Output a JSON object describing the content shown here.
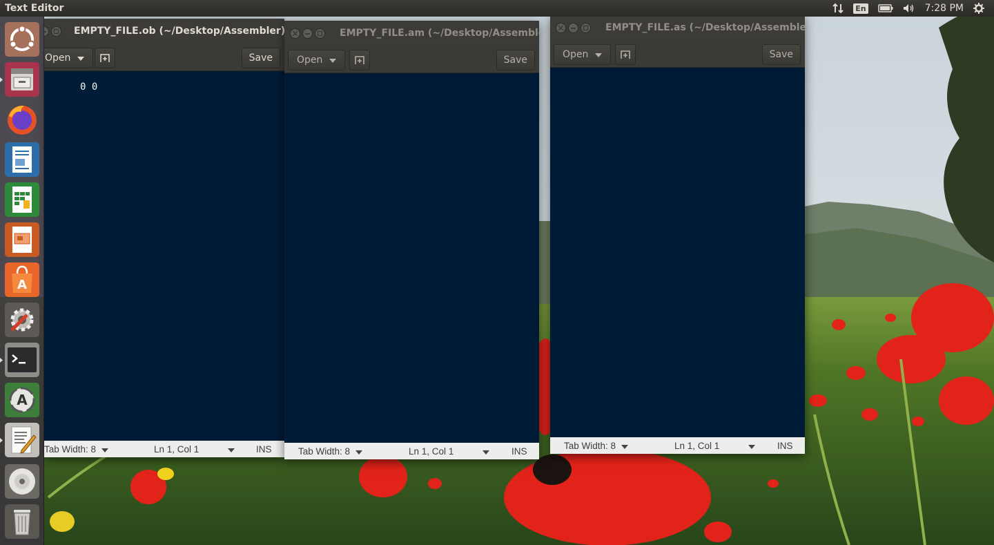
{
  "panel": {
    "app_title": "Text Editor",
    "keyboard_layout": "En",
    "clock": "7:28 PM",
    "icons": [
      "network-transfer-icon",
      "keyboard-layout-icon",
      "battery-icon",
      "volume-icon",
      "system-gear-icon"
    ]
  },
  "launcher": {
    "items": [
      {
        "name": "ubuntu-dash-icon"
      },
      {
        "name": "files-icon"
      },
      {
        "name": "firefox-icon"
      },
      {
        "name": "libreoffice-writer-icon"
      },
      {
        "name": "libreoffice-calc-icon"
      },
      {
        "name": "libreoffice-impress-icon"
      },
      {
        "name": "ubuntu-software-icon"
      },
      {
        "name": "system-settings-icon"
      },
      {
        "name": "terminal-icon"
      },
      {
        "name": "software-updater-icon"
      },
      {
        "name": "text-editor-icon"
      },
      {
        "name": "dvd-drive-icon"
      },
      {
        "name": "trash-icon"
      }
    ]
  },
  "windows": [
    {
      "title": "EMPTY_FILE.ob (~/Desktop/Assembler) - gedit",
      "open_label": "Open",
      "save_label": "Save",
      "content_lines": [
        "0 0"
      ],
      "status": {
        "tab_width": "Tab Width: 8",
        "position": "Ln 1, Col 1",
        "mode": "INS"
      }
    },
    {
      "title": "EMPTY_FILE.am (~/Desktop/Assembler) - gedit",
      "open_label": "Open",
      "save_label": "Save",
      "content_lines": [],
      "status": {
        "tab_width": "Tab Width: 8",
        "position": "Ln 1, Col 1",
        "mode": "INS"
      }
    },
    {
      "title": "EMPTY_FILE.as (~/Desktop/Assembler) - gedit",
      "open_label": "Open",
      "save_label": "Save",
      "content_lines": [],
      "status": {
        "tab_width": "Tab Width: 8",
        "position": "Ln 1, Col 1",
        "mode": "INS"
      }
    }
  ],
  "colors": {
    "panel_bg": "#3c3b37",
    "editor_bg": "#001b36",
    "editor_fg": "#f8f8f2",
    "statusbar_bg": "#edeeec"
  }
}
